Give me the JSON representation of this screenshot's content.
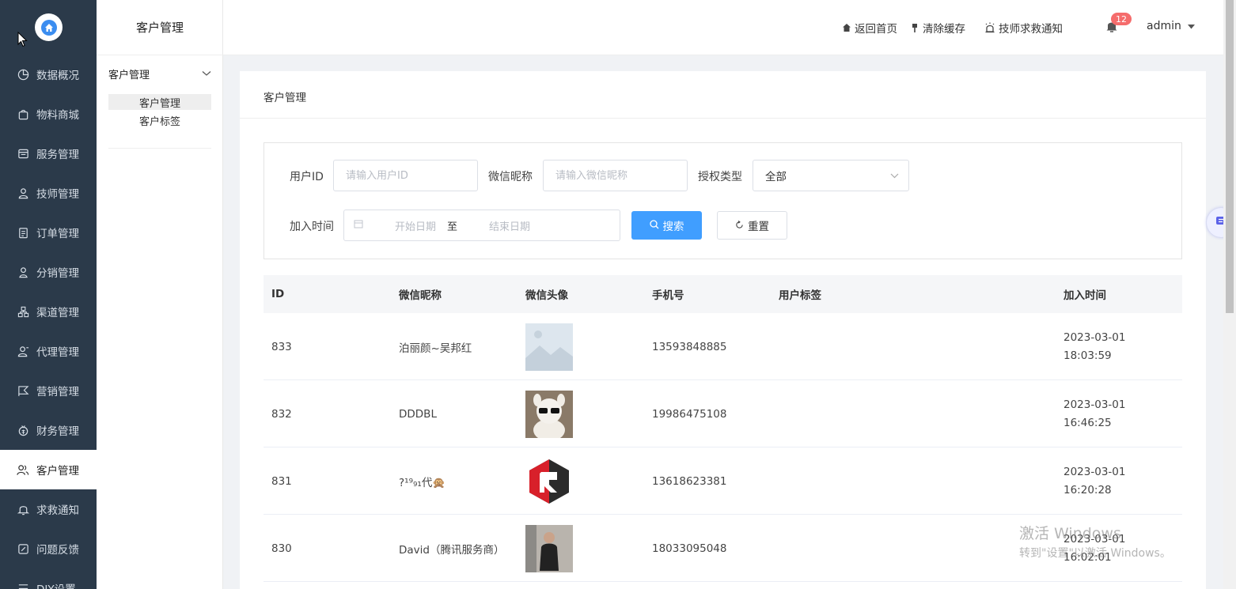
{
  "sidebar": {
    "items": [
      {
        "label": "数据概况",
        "icon": "pie-chart-icon"
      },
      {
        "label": "物料商城",
        "icon": "shopping-bag-icon"
      },
      {
        "label": "服务管理",
        "icon": "service-icon"
      },
      {
        "label": "技师管理",
        "icon": "technician-icon"
      },
      {
        "label": "订单管理",
        "icon": "order-icon"
      },
      {
        "label": "分销管理",
        "icon": "distribution-icon"
      },
      {
        "label": "渠道管理",
        "icon": "channel-icon"
      },
      {
        "label": "代理管理",
        "icon": "agent-icon"
      },
      {
        "label": "营销管理",
        "icon": "marketing-icon"
      },
      {
        "label": "财务管理",
        "icon": "finance-icon"
      },
      {
        "label": "客户管理",
        "icon": "customers-icon",
        "active": true
      },
      {
        "label": "求救通知",
        "icon": "bell-icon"
      },
      {
        "label": "问题反馈",
        "icon": "feedback-icon"
      },
      {
        "label": "DIY设置",
        "icon": "settings-icon"
      }
    ]
  },
  "subnav": {
    "title": "客户管理",
    "group_label": "客户管理",
    "items": [
      {
        "label": "客户管理",
        "active": true
      },
      {
        "label": "客户标签",
        "active": false
      }
    ]
  },
  "header": {
    "home_label": "返回首页",
    "clear_cache_label": "清除缓存",
    "sos_label": "技师求救通知",
    "notification_count": "12",
    "username": "admin"
  },
  "card": {
    "breadcrumb": "客户管理"
  },
  "filter": {
    "user_id_label": "用户ID",
    "user_id_placeholder": "请输入用户ID",
    "nickname_label": "微信昵称",
    "nickname_placeholder": "请输入微信昵称",
    "auth_type_label": "授权类型",
    "auth_type_value": "全部",
    "join_time_label": "加入时间",
    "start_placeholder": "开始日期",
    "range_sep": "至",
    "end_placeholder": "结束日期",
    "search_label": "搜索",
    "reset_label": "重置"
  },
  "table": {
    "headers": [
      "ID",
      "微信昵称",
      "微信头像",
      "手机号",
      "用户标签",
      "加入时间"
    ],
    "rows": [
      {
        "id": "833",
        "nickname": "泊丽颜~吴邦红",
        "avatar": "placeholder",
        "phone": "13593848885",
        "tag": "",
        "date": "2023-03-01",
        "time": "18:03:59"
      },
      {
        "id": "832",
        "nickname": "DDDBL",
        "avatar": "toy",
        "phone": "19986475108",
        "tag": "",
        "date": "2023-03-01",
        "time": "16:46:25"
      },
      {
        "id": "831",
        "nickname": "?¹⁹₉₁代🙊",
        "avatar": "logo",
        "phone": "13618623381",
        "tag": "",
        "date": "2023-03-01",
        "time": "16:20:28"
      },
      {
        "id": "830",
        "nickname": "David（腾讯服务商）",
        "avatar": "person",
        "phone": "18033095048",
        "tag": "",
        "date": "2023-03-01",
        "time": "16:02:01"
      }
    ]
  },
  "watermark": {
    "line1": "激活 Windows",
    "line2": "转到\"设置\"以激活 Windows。"
  },
  "colors": {
    "sidebar_bg": "#2b3a4a",
    "primary": "#409eff",
    "badge": "#f56c6c"
  }
}
